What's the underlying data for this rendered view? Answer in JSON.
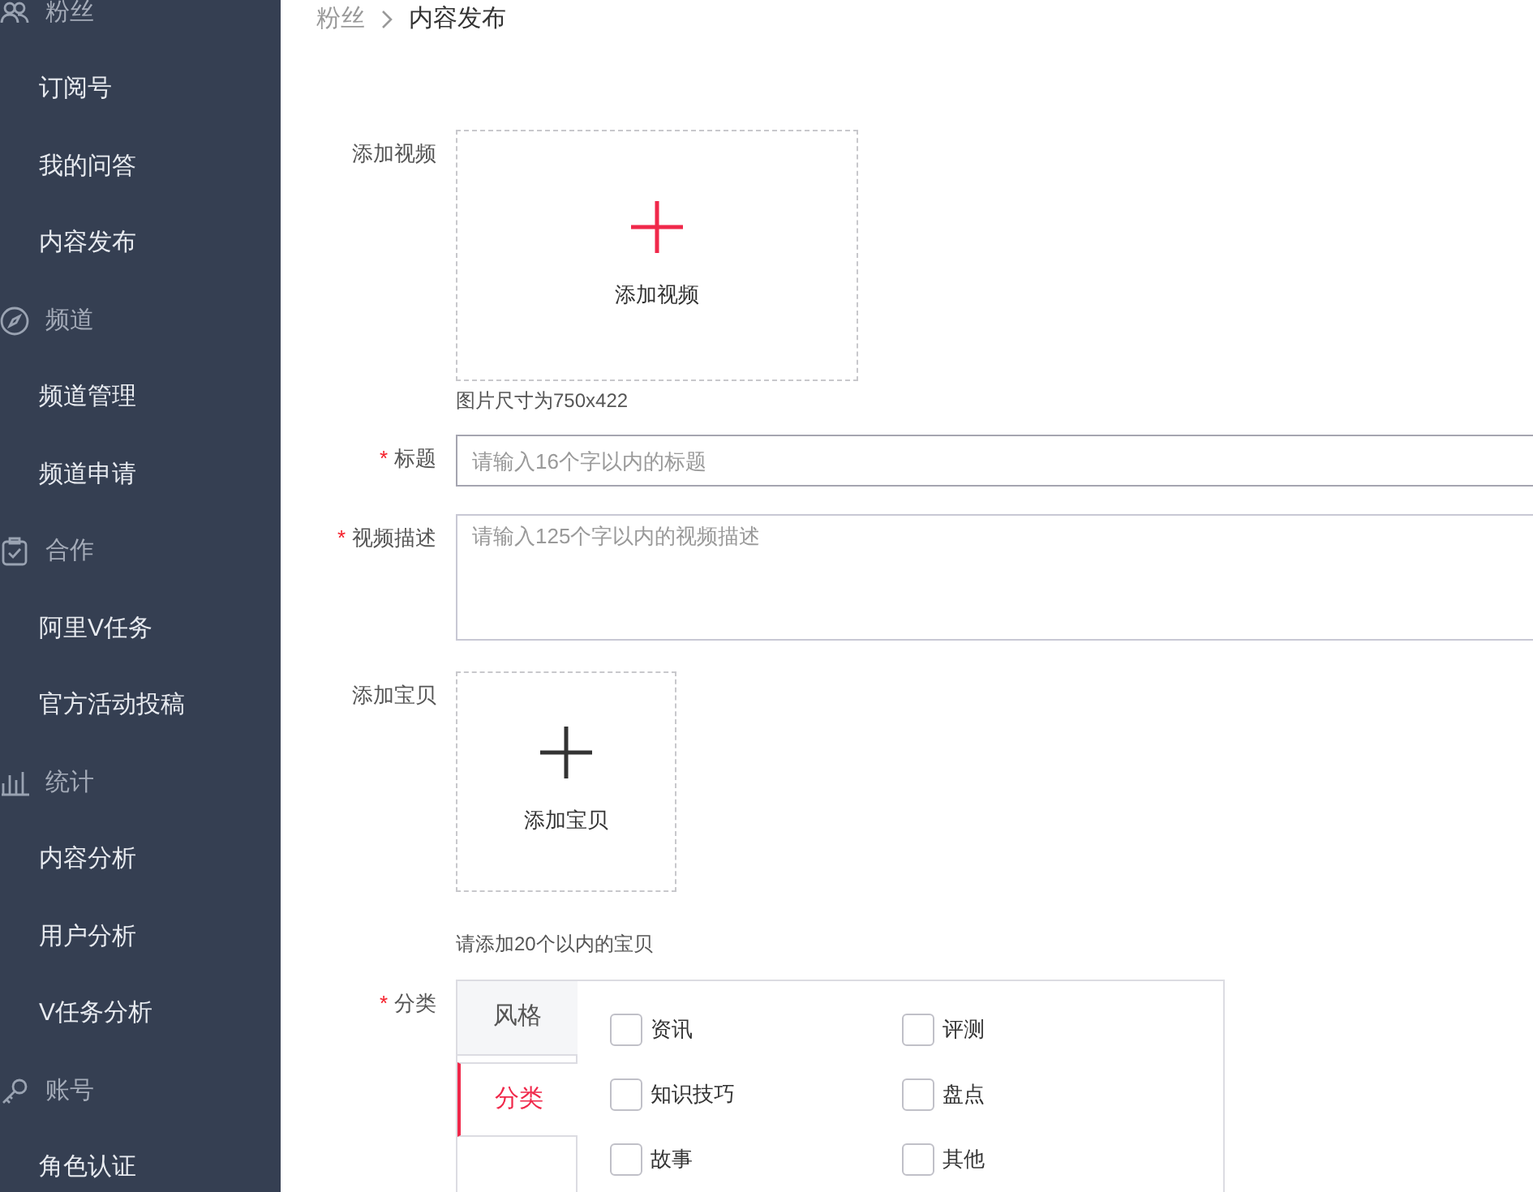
{
  "sidebar": {
    "groups": [
      {
        "label": "粉丝",
        "children": [
          {
            "label": "订阅号"
          },
          {
            "label": "我的问答"
          },
          {
            "label": "内容发布"
          }
        ]
      },
      {
        "label": "频道",
        "children": [
          {
            "label": "频道管理"
          },
          {
            "label": "频道申请"
          }
        ]
      },
      {
        "label": "合作",
        "children": [
          {
            "label": "阿里V任务"
          },
          {
            "label": "官方活动投稿"
          }
        ]
      },
      {
        "label": "统计",
        "children": [
          {
            "label": "内容分析"
          },
          {
            "label": "用户分析"
          },
          {
            "label": "V任务分析"
          }
        ]
      },
      {
        "label": "账号",
        "children": [
          {
            "label": "角色认证"
          }
        ]
      }
    ]
  },
  "breadcrumb": [
    {
      "label": "粉丝"
    },
    {
      "label": "内容发布"
    }
  ],
  "form": [
    {
      "kind": "upload",
      "label": "添加视频",
      "button": "添加视频",
      "accent": true,
      "hint": "图片尺寸为750x422"
    },
    {
      "kind": "input",
      "label": "标题",
      "required_mark": "*",
      "placeholder": "请输入16个字以内的标题"
    },
    {
      "kind": "textarea",
      "label": "视频描述",
      "required_mark": "*",
      "placeholder": "请输入125个字以内的视频描述"
    },
    {
      "kind": "upload",
      "label": "添加宝贝",
      "button": "添加宝贝",
      "accent": false,
      "hint": "请添加20个以内的宝贝"
    },
    {
      "kind": "tabs",
      "label": "分类",
      "required_mark": "*",
      "tabs": [
        {
          "label": "风格",
          "selected": false
        },
        {
          "label": "分类",
          "selected": true
        }
      ],
      "options": [
        {
          "label": "资讯",
          "checked": false
        },
        {
          "label": "评测",
          "checked": false
        },
        {
          "label": "知识技巧",
          "checked": false
        },
        {
          "label": "盘点",
          "checked": false
        },
        {
          "label": "故事",
          "checked": false
        },
        {
          "label": "其他",
          "checked": false
        }
      ]
    }
  ]
}
